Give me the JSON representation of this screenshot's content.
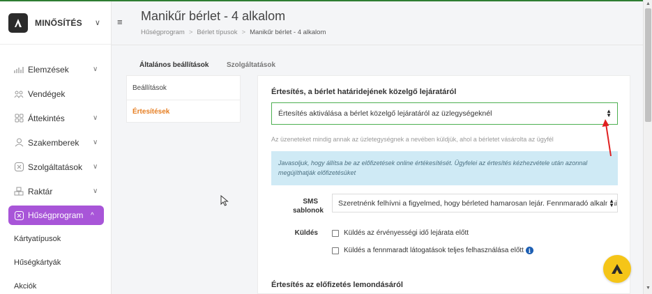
{
  "brand": {
    "name": "MINŐSÍTÉS"
  },
  "header": {
    "title": "Manikűr bérlet - 4 alkalom",
    "breadcrumb": [
      "Hűségprogram",
      "Bérlet típusok",
      "Manikűr bérlet - 4 alkalom"
    ],
    "breadcrumb_sep": ">"
  },
  "sidebar": {
    "items": [
      {
        "label": "Elemzések",
        "icon": "chart-icon",
        "chevron": "∨"
      },
      {
        "label": "Vendégek",
        "icon": "guests-icon"
      },
      {
        "label": "Áttekintés",
        "icon": "grid-icon",
        "chevron": "∨"
      },
      {
        "label": "Szakemberek",
        "icon": "user-icon",
        "chevron": "∨"
      },
      {
        "label": "Szolgáltatások",
        "icon": "scissors-icon",
        "chevron": "∨"
      },
      {
        "label": "Raktár",
        "icon": "boxes-icon",
        "chevron": "∨"
      },
      {
        "label": "Hűségprogram",
        "icon": "loyalty-icon",
        "chevron": "^",
        "active": true
      }
    ],
    "sub_items": [
      "Kártyatípusok",
      "Hűségkártyák",
      "Akciók"
    ]
  },
  "tabs": {
    "general": "Általános beállítások",
    "services": "Szolgáltatások"
  },
  "subnav": {
    "settings": "Beállítások",
    "notifications": "Értesítések"
  },
  "expiry_section": {
    "title": "Értesítés, a bérlet határidejének közelgő lejáratáról",
    "select_value": "Értesítés aktiválása a bérlet közelgő lejáratáról az üzlegységeknél",
    "hint": "Az üzeneteket mindig annak az üzletegységnek a nevében küldjük, ahol a bérletet vásárolta az ügyfél",
    "info": "Javasoljuk, hogy állítsa be az előfizetések online értékesítését. Ügyfelei az értesítés kézhezvétele után azonnal megújíthatják előfizetésüket",
    "sms_label": "SMS sablonok",
    "sms_value": "Szeretnénk felhívni a figyelmed, hogy bérleted hamarosan lejár. Fennmaradó alkalmaid",
    "send_label": "Küldés",
    "check1": "Küldés az érvényességi idő lejárata előtt",
    "check2": "Küldés a fennmaradt látogatások teljes felhasználása előtt"
  },
  "cancel_section": {
    "title": "Értesítés az előfizetés lemondásáról"
  },
  "colors": {
    "accent": "#a855d8",
    "active_subnav": "#e67e22",
    "fab": "#f5c518",
    "info_bg": "#cfeaf5",
    "focus": "#4caf50",
    "annotation": "#e02020"
  }
}
